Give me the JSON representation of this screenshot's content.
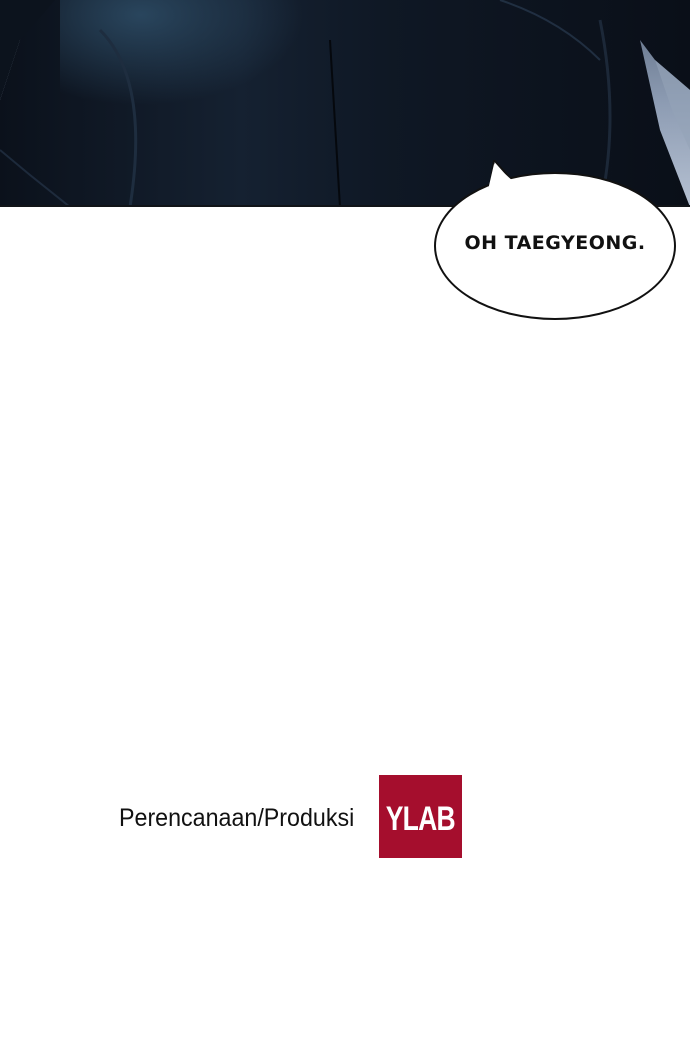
{
  "speech_bubble": {
    "text": "OH TAEGYEONG."
  },
  "credits": {
    "label": "Perencanaan/Produksi",
    "studio_logo_text": "YLAB"
  },
  "colors": {
    "logo_background": "#a50e2d",
    "panel_dark": "#0d1521"
  }
}
